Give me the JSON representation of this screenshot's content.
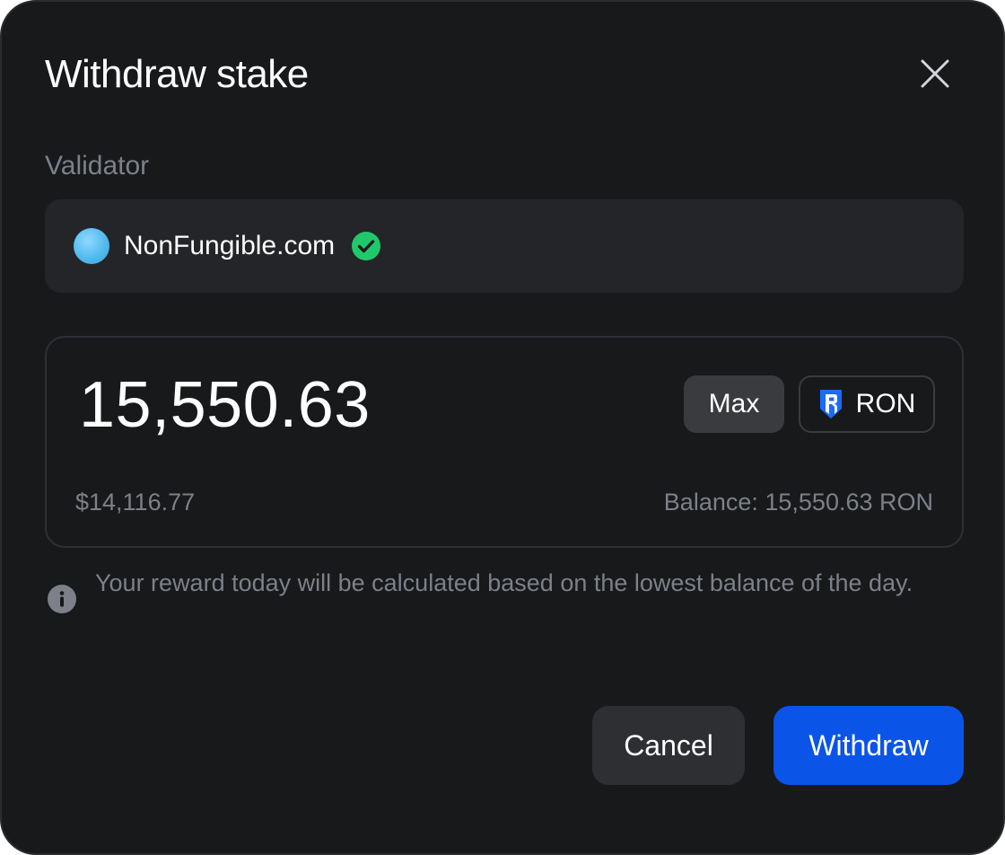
{
  "dialog": {
    "title": "Withdraw stake",
    "close_icon": "close-icon"
  },
  "validator": {
    "label": "Validator",
    "name": "NonFungible.com",
    "verified_icon": "check-circle-icon",
    "avatar_color": "#4fb8ec"
  },
  "amount": {
    "value": "15,550.63",
    "usd_value": "$14,116.77",
    "balance": "Balance: 15,550.63 RON",
    "max_label": "Max",
    "token": "RON",
    "token_icon": "ronin-logo-icon"
  },
  "info": {
    "icon": "info-icon",
    "text": "Your reward today will be calculated based on the lowest balance of the day."
  },
  "actions": {
    "cancel_label": "Cancel",
    "withdraw_label": "Withdraw"
  },
  "colors": {
    "background": "#18191b",
    "accent": "#0a54e8",
    "verified": "#1fc96b"
  }
}
